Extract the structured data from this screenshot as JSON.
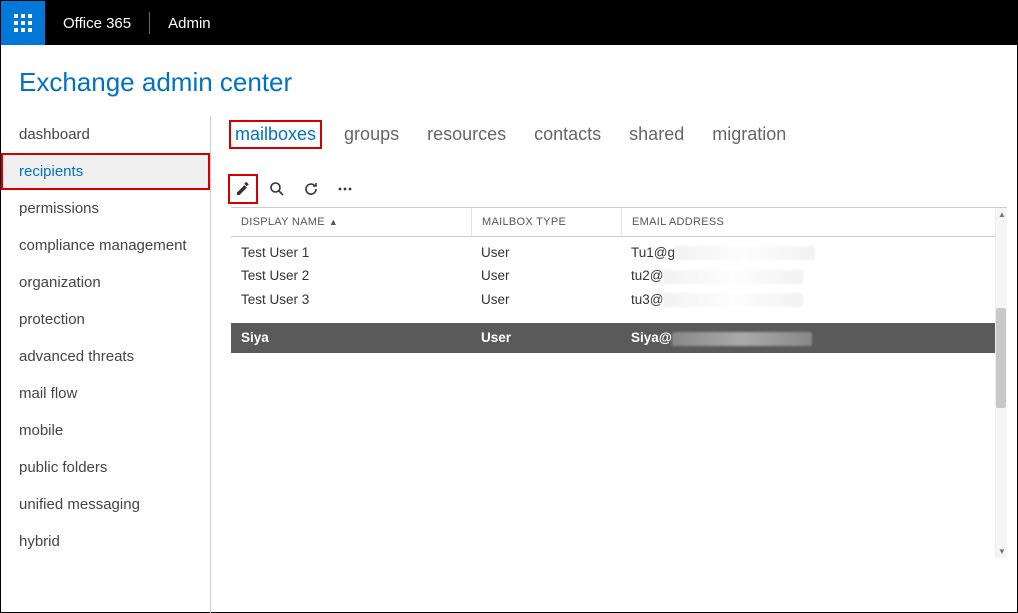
{
  "topbar": {
    "brand": "Office 365",
    "section": "Admin"
  },
  "page_title": "Exchange admin center",
  "sidebar": {
    "items": [
      {
        "label": "dashboard",
        "active": false
      },
      {
        "label": "recipients",
        "active": true,
        "highlight": true
      },
      {
        "label": "permissions",
        "active": false
      },
      {
        "label": "compliance management",
        "active": false
      },
      {
        "label": "organization",
        "active": false
      },
      {
        "label": "protection",
        "active": false
      },
      {
        "label": "advanced threats",
        "active": false
      },
      {
        "label": "mail flow",
        "active": false
      },
      {
        "label": "mobile",
        "active": false
      },
      {
        "label": "public folders",
        "active": false
      },
      {
        "label": "unified messaging",
        "active": false
      },
      {
        "label": "hybrid",
        "active": false
      }
    ]
  },
  "tabs": [
    {
      "label": "mailboxes",
      "active": true,
      "highlight": true
    },
    {
      "label": "groups"
    },
    {
      "label": "resources"
    },
    {
      "label": "contacts"
    },
    {
      "label": "shared"
    },
    {
      "label": "migration"
    }
  ],
  "toolbar": {
    "edit": "edit-icon",
    "search": "search-icon",
    "refresh": "refresh-icon",
    "more": "more-icon"
  },
  "table": {
    "columns": {
      "display_name": "DISPLAY NAME",
      "mailbox_type": "MAILBOX TYPE",
      "email_address": "EMAIL ADDRESS"
    },
    "rows": [
      {
        "name": "Test User 1",
        "type": "User",
        "email_prefix": "Tu1@g"
      },
      {
        "name": "Test User 2",
        "type": "User",
        "email_prefix": "tu2@"
      },
      {
        "name": "Test User 3",
        "type": "User",
        "email_prefix": "tu3@"
      },
      {
        "name": "Siya",
        "type": "User",
        "email_prefix": "Siya@",
        "selected": true
      }
    ]
  }
}
